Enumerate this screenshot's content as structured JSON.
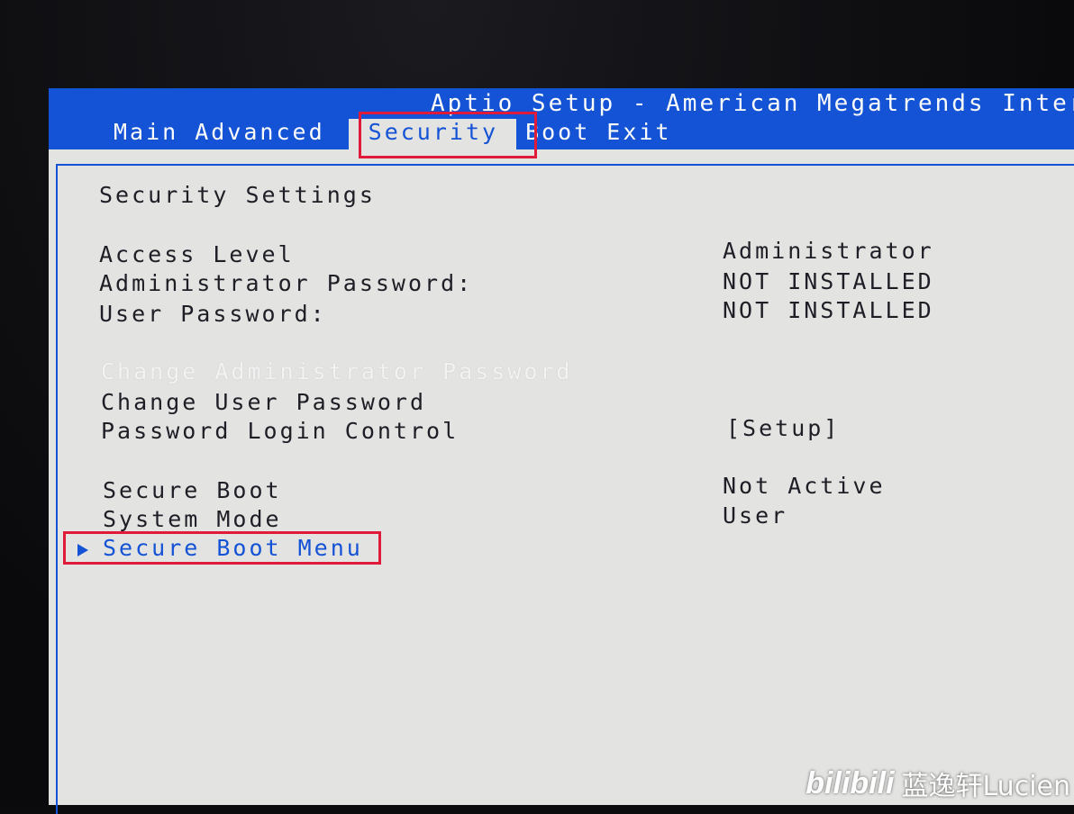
{
  "bios": {
    "title": "Aptio Setup - American Megatrends Inter",
    "tabs": [
      {
        "label": "Main"
      },
      {
        "label": "Advanced"
      },
      {
        "label": "Security"
      },
      {
        "label": "Boot"
      },
      {
        "label": "Exit"
      }
    ],
    "active_tab": "Security"
  },
  "security": {
    "section_title": "Security Settings",
    "access_level_label": "Access Level",
    "access_level_value": "Administrator",
    "admin_password_label": "Administrator Password:",
    "admin_password_value": "NOT INSTALLED",
    "user_password_label": "User Password:",
    "user_password_value": "NOT INSTALLED",
    "change_admin_password": "Change Administrator Password",
    "change_user_password": "Change User Password",
    "password_login_control_label": "Password Login Control",
    "password_login_control_value": "[Setup]",
    "secure_boot_label": "Secure Boot",
    "secure_boot_value": "Not Active",
    "system_mode_label": "System Mode",
    "system_mode_value": "User",
    "secure_boot_menu": "Secure Boot Menu"
  },
  "watermark": {
    "logo": "bilibili",
    "author": "蓝逸轩Lucien"
  },
  "colors": {
    "bios_blue": "#1553d6",
    "panel_gray": "#e3e3e1",
    "highlight_red": "#e01b3a"
  }
}
